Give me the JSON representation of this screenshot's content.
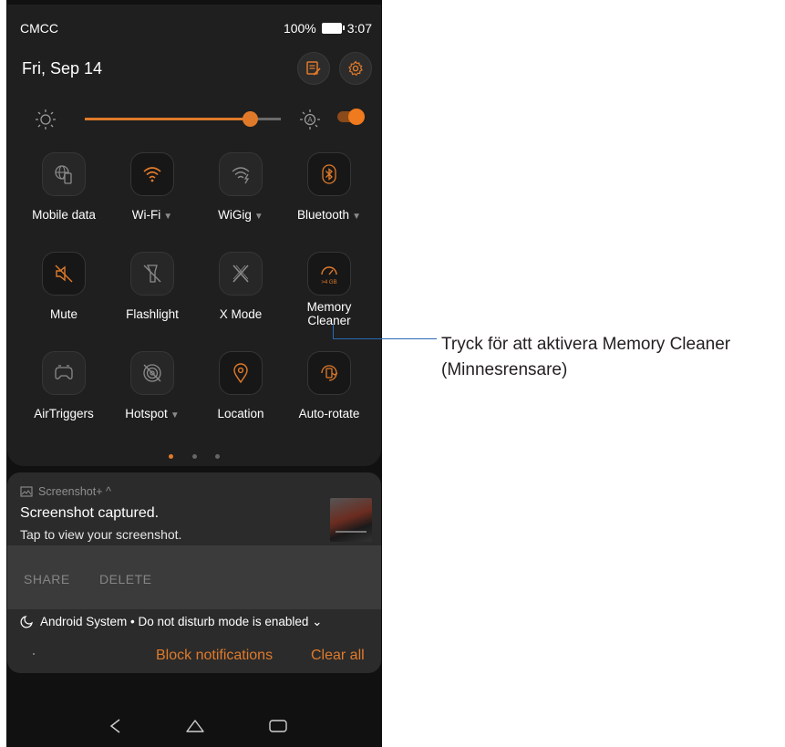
{
  "status_bar": {
    "carrier": "CMCC",
    "battery": "100%",
    "time": "3:07"
  },
  "header": {
    "date": "Fri, Sep 14",
    "edit_icon": "edit-icon",
    "settings_icon": "gear-icon"
  },
  "brightness": {
    "level": 0.84,
    "auto": true,
    "accent": "#e07a2a"
  },
  "tiles": [
    {
      "label": "Mobile data",
      "icon": "globe-phone-icon",
      "active": false,
      "caret": ""
    },
    {
      "label": "Wi-Fi",
      "icon": "wifi-icon",
      "active": true,
      "caret": "▼"
    },
    {
      "label": "WiGig",
      "icon": "wigig-icon",
      "active": false,
      "caret": "▼"
    },
    {
      "label": "Bluetooth",
      "icon": "bluetooth-icon",
      "active": true,
      "caret": "▼"
    },
    {
      "label": "Mute",
      "icon": "mute-icon",
      "active": true,
      "caret": ""
    },
    {
      "label": "Flashlight",
      "icon": "flashlight-icon",
      "active": false,
      "caret": ""
    },
    {
      "label": "X Mode",
      "icon": "x-mode-icon",
      "active": false,
      "caret": ""
    },
    {
      "label": "Memory\nCleaner",
      "icon": "memory-cleaner-icon",
      "active": true,
      "caret": "",
      "sublabel": ">4 GB"
    },
    {
      "label": "AirTriggers",
      "icon": "airtriggers-icon",
      "active": false,
      "caret": ""
    },
    {
      "label": "Hotspot",
      "icon": "hotspot-icon",
      "active": false,
      "caret": "▼"
    },
    {
      "label": "Location",
      "icon": "location-icon",
      "active": true,
      "caret": ""
    },
    {
      "label": "Auto-rotate",
      "icon": "auto-rotate-icon",
      "active": true,
      "caret": ""
    }
  ],
  "pager": {
    "pages": 3,
    "current": 1
  },
  "notification": {
    "app": "Screenshot+ ^",
    "title": "Screenshot captured.",
    "text": "Tap to view your screenshot.",
    "actions": {
      "share": "SHARE",
      "delete": "DELETE"
    }
  },
  "dnd": {
    "text": "Android System • Do not disturb mode is enabled ⌄"
  },
  "footer": {
    "block": "Block notifications",
    "clear": "Clear all"
  },
  "navbar": {
    "back": "back-icon",
    "home": "home-icon",
    "recents": "recents-icon"
  },
  "callout": {
    "line1": "Tryck för att aktivera Memory Cleaner",
    "line2": "(Minnesrensare)"
  }
}
